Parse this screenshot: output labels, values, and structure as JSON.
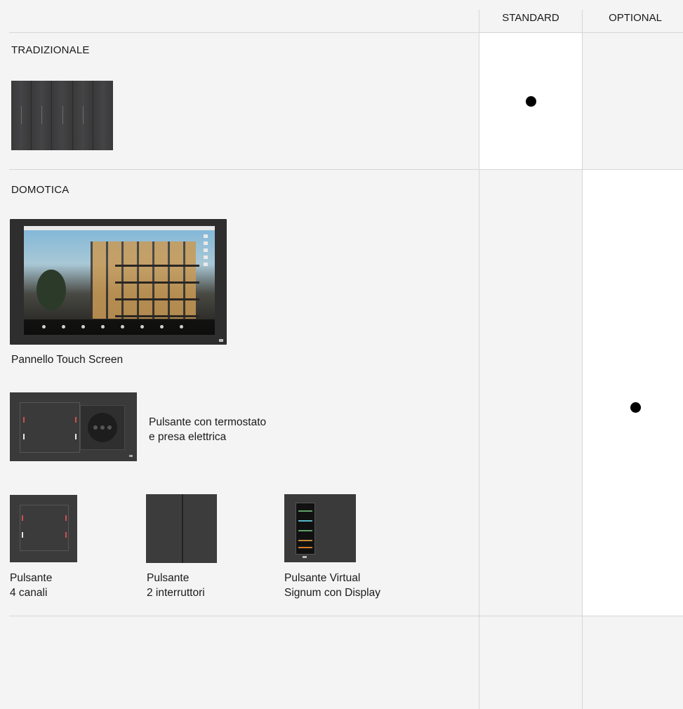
{
  "columns": {
    "standard": "STANDARD",
    "optional": "OPTIONAL"
  },
  "sections": {
    "tradizionale": {
      "title": "TRADIZIONALE",
      "standard": true,
      "optional": false
    },
    "domotica": {
      "title": "DOMOTICA",
      "standard": false,
      "optional": true,
      "products": {
        "touch_screen": {
          "label": "Pannello Touch Screen"
        },
        "termostato": {
          "line1": "Pulsante con termostato",
          "line2": "e presa elettrica"
        },
        "quattro_canali": {
          "line1": "Pulsante",
          "line2": "4 canali"
        },
        "due_interruttori": {
          "line1": "Pulsante",
          "line2": "2 interruttori"
        },
        "virtual": {
          "line1": "Pulsante Virtual",
          "line2": "Signum con Display"
        }
      }
    }
  },
  "icons": {
    "standard_marker": "filled-dot-icon",
    "optional_marker": "filled-dot-icon"
  },
  "colors": {
    "background": "#f4f4f4",
    "highlight_cell": "#ffffff",
    "divider": "#d6d6d6",
    "marker": "#000000"
  }
}
